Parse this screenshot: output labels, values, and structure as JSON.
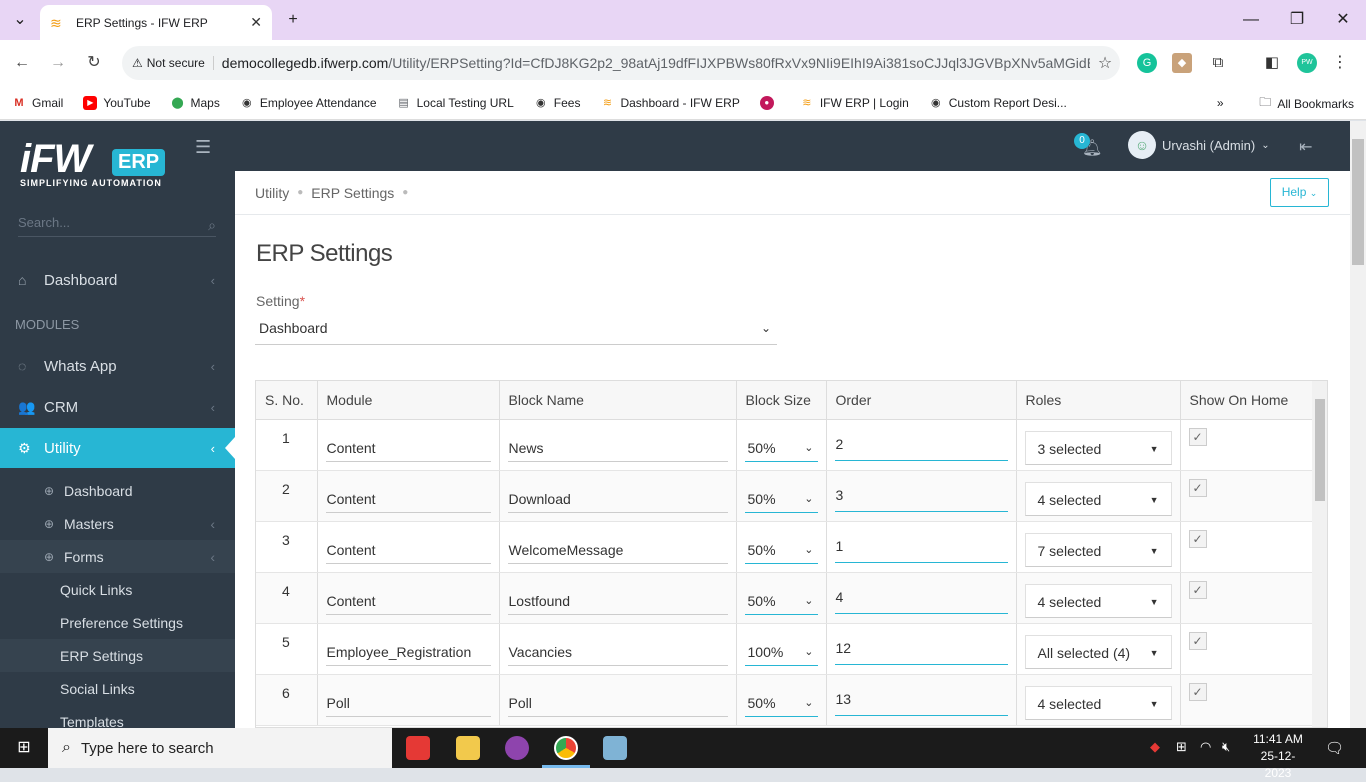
{
  "browser": {
    "tab_title": "ERP Settings - IFW ERP",
    "not_secure": "Not secure",
    "url_host": "democollegedb.ifwerp.com",
    "url_path": "/Utility/ERPSetting?Id=CfDJ8KG2p2_98atAj19dfFIJXPBWs80fRxVx9NIi9EIhI9Ai381soCJJql3JGVBpXNv5aMGidBl...",
    "bookmarks": [
      "Gmail",
      "YouTube",
      "Maps",
      "Employee Attendance",
      "Local Testing URL",
      "Fees",
      "Dashboard - IFW ERP",
      "",
      "IFW ERP | Login",
      "Custom Report Desi..."
    ],
    "all_bookmarks": "All Bookmarks",
    "ext_pw": "PW"
  },
  "logo": {
    "main": "iFW",
    "erp": "ERP",
    "tagline": "SIMPLIFYING AUTOMATION"
  },
  "sidebar": {
    "search_placeholder": "Search...",
    "dashboard": "Dashboard",
    "modules_header": "MODULES",
    "whatsapp": "Whats App",
    "crm": "CRM",
    "utility": "Utility",
    "sub_dashboard": "Dashboard",
    "masters": "Masters",
    "forms": "Forms",
    "quick_links": "Quick Links",
    "preference_settings": "Preference Settings",
    "erp_settings": "ERP Settings",
    "social_links": "Social Links",
    "templates": "Templates"
  },
  "topbar": {
    "notifications": "0",
    "user": "Urvashi (Admin)"
  },
  "breadcrumb": {
    "root": "Utility",
    "current": "ERP Settings"
  },
  "help_label": "Help",
  "page_title": "ERP Settings",
  "setting": {
    "label": "Setting",
    "required": "*",
    "value": "Dashboard"
  },
  "table": {
    "headers": [
      "S. No.",
      "Module",
      "Block Name",
      "Block Size",
      "Order",
      "Roles",
      "Show On Home"
    ],
    "rows": [
      {
        "sno": "1",
        "module": "Content",
        "block": "News",
        "size": "50%",
        "order": "2",
        "roles": "3 selected",
        "show": true
      },
      {
        "sno": "2",
        "module": "Content",
        "block": "Download",
        "size": "50%",
        "order": "3",
        "roles": "4 selected",
        "show": true
      },
      {
        "sno": "3",
        "module": "Content",
        "block": "WelcomeMessage",
        "size": "50%",
        "order": "1",
        "roles": "7 selected",
        "show": true
      },
      {
        "sno": "4",
        "module": "Content",
        "block": "Lostfound",
        "size": "50%",
        "order": "4",
        "roles": "4 selected",
        "show": true
      },
      {
        "sno": "5",
        "module": "Employee_Registration",
        "block": "Vacancies",
        "size": "100%",
        "order": "12",
        "roles": "All selected (4)",
        "show": true
      },
      {
        "sno": "6",
        "module": "Poll",
        "block": "Poll",
        "size": "50%",
        "order": "13",
        "roles": "4 selected",
        "show": true
      }
    ]
  },
  "taskbar": {
    "search": "Type here to search",
    "time": "11:41 AM",
    "date": "25-12-2023"
  },
  "colors": {
    "accent": "#27b6d4",
    "sidebar": "#2f3b47"
  }
}
